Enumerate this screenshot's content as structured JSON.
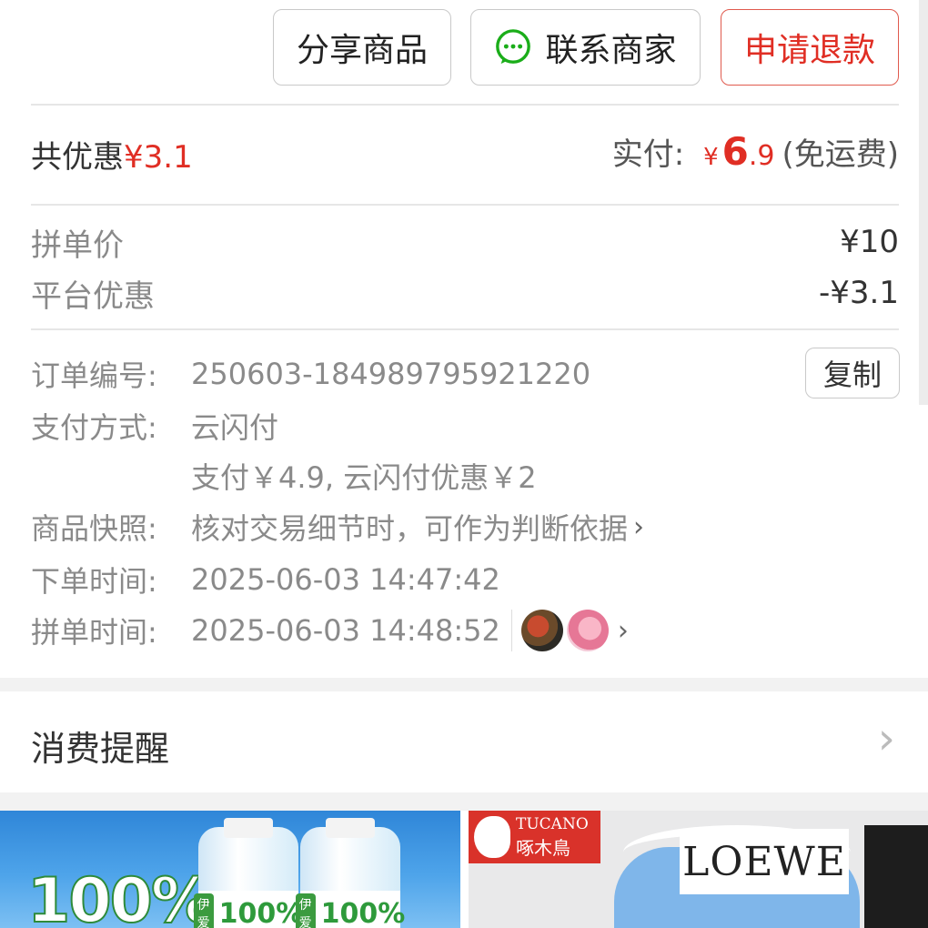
{
  "actions": {
    "share_label": "分享商品",
    "contact_label": "联系商家",
    "refund_label": "申请退款"
  },
  "summary": {
    "discount_prefix": "共优惠",
    "discount_amount": "¥3.1",
    "paid_prefix": "实付: ",
    "currency": "¥",
    "paid_integer": "6",
    "paid_decimal": ".9",
    "shipping_note": "(免运费)"
  },
  "price_details": [
    {
      "label": "拼单价",
      "value": "¥10"
    },
    {
      "label": "平台优惠",
      "value": "-¥3.1"
    }
  ],
  "order_info": {
    "order_no_label": "订单编号:",
    "order_no": "250603-184989795921220",
    "copy_label": "复制",
    "pay_method_label": "支付方式:",
    "pay_method": "云闪付",
    "pay_detail": "支付￥4.9, 云闪付优惠￥2",
    "snapshot_label": "商品快照:",
    "snapshot_text": "核对交易细节时，可作为判断依据",
    "order_time_label": "下单时间:",
    "order_time": "2025-06-03 14:47:42",
    "group_time_label": "拼单时间:",
    "group_time": "2025-06-03 14:48:52"
  },
  "reminder": {
    "title": "消费提醒"
  },
  "recommendations": [
    {
      "brand": "伊爱",
      "badge": "100%",
      "label_text": "100%"
    },
    {
      "brand_en": "TUCANO",
      "brand_cn": "啄木鳥",
      "tag_text": "LOEWE"
    }
  ],
  "colors": {
    "accent_red": "#e02e24",
    "wechat_green": "#1aad19"
  },
  "icons": {
    "chat": "chat-bubble-icon",
    "chevron": "chevron-right-icon"
  }
}
